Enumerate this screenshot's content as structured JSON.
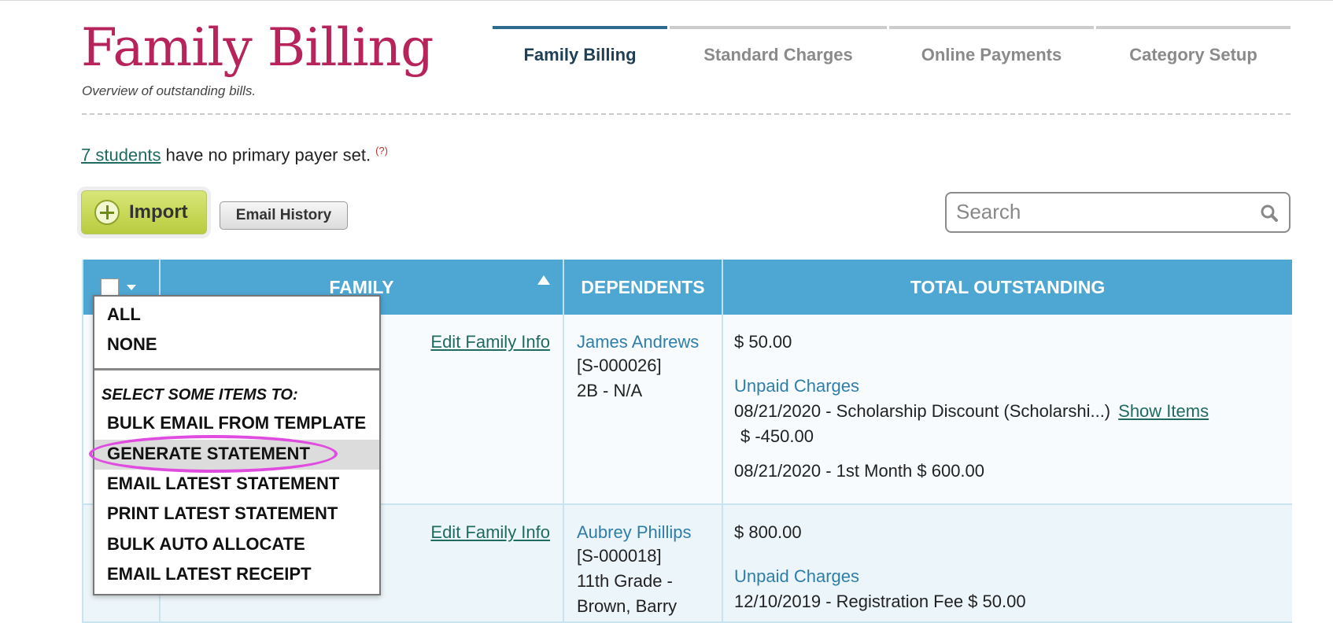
{
  "header": {
    "title": "Family Billing",
    "subtitle": "Overview of outstanding bills."
  },
  "tabs": [
    {
      "label": "Family Billing",
      "active": true
    },
    {
      "label": "Standard Charges",
      "active": false
    },
    {
      "label": "Online Payments",
      "active": false
    },
    {
      "label": "Category Setup",
      "active": false
    }
  ],
  "notice": {
    "link_text": "7 students",
    "text": " have no primary payer set.",
    "help": "(?)"
  },
  "toolbar": {
    "import_label": "Import",
    "email_history_label": "Email History",
    "search_placeholder": "Search"
  },
  "table": {
    "headers": {
      "family": "FAMILY",
      "dependents": "DEPENDENTS",
      "total": "TOTAL OUTSTANDING"
    },
    "rows": [
      {
        "edit_label": "Edit Family Info",
        "dependent_name": "James Andrews",
        "dependent_id": "[S-000026]",
        "dependent_grade": "2B - N/A",
        "dependent_grade_2": "",
        "total": "$ 50.00",
        "unpaid_label": "Unpaid Charges",
        "charge1": "08/21/2020 - Scholarship Discount  (Scholarshi...)",
        "show_items": "Show Items",
        "charge1_amount": "$ -450.00",
        "charge2": "08/21/2020 - 1st Month $ 600.00"
      },
      {
        "edit_label": "Edit Family Info",
        "dependent_name": "Aubrey Phillips",
        "dependent_id": "[S-000018]",
        "dependent_grade": "11th Grade -",
        "dependent_grade_2": "Brown, Barry",
        "total": "$ 800.00",
        "unpaid_label": "Unpaid Charges",
        "charge1": "12/10/2019 - Registration Fee $ 50.00"
      }
    ]
  },
  "dropdown": {
    "select": [
      "ALL",
      "NONE"
    ],
    "heading": "SELECT SOME ITEMS TO:",
    "actions": [
      "BULK EMAIL FROM TEMPLATE",
      "GENERATE STATEMENT",
      "EMAIL LATEST STATEMENT",
      "PRINT LATEST STATEMENT",
      "BULK AUTO ALLOCATE",
      "EMAIL LATEST RECEIPT"
    ],
    "highlighted": "GENERATE STATEMENT"
  },
  "colors": {
    "title": "#b7245c",
    "table_header": "#4ea6d3",
    "active_tab": "#2e6b8f",
    "link": "#1f6b60",
    "dependent": "#2f7ea8",
    "import_button": "#c6d75a",
    "annotation_ring": "#e04be0"
  }
}
